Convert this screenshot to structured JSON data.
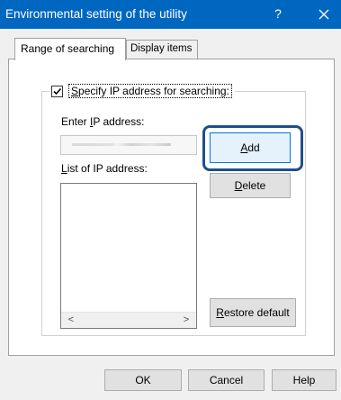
{
  "window": {
    "title": "Environmental setting of the utility",
    "help_glyph": "?",
    "close_icon": "close-icon"
  },
  "tabs": [
    {
      "label": "Range of searching",
      "selected": true
    },
    {
      "label": "Display items",
      "selected": false
    }
  ],
  "group": {
    "checkbox_label": {
      "prefix": "",
      "mnemonic": "S",
      "rest": "pecify IP address for searching:"
    },
    "checked": true
  },
  "enter_ip": {
    "label": {
      "prefix": "Enter ",
      "mnemonic": "I",
      "rest": "P address:"
    }
  },
  "list": {
    "label": {
      "prefix": "",
      "mnemonic": "L",
      "rest": "ist of IP address:"
    },
    "scroll_left": "<",
    "scroll_right": ">"
  },
  "buttons": {
    "add": {
      "prefix": "",
      "mnemonic": "A",
      "rest": "dd"
    },
    "delete": {
      "prefix": "",
      "mnemonic": "D",
      "rest": "elete"
    },
    "restore": {
      "prefix": "",
      "mnemonic": "R",
      "rest": "estore default"
    }
  },
  "footer": {
    "ok": "OK",
    "cancel": "Cancel",
    "help": "Help"
  },
  "colors": {
    "titlebar": "#0067c0",
    "highlight": "#1f4f8a",
    "focused_border": "#0078d7"
  }
}
